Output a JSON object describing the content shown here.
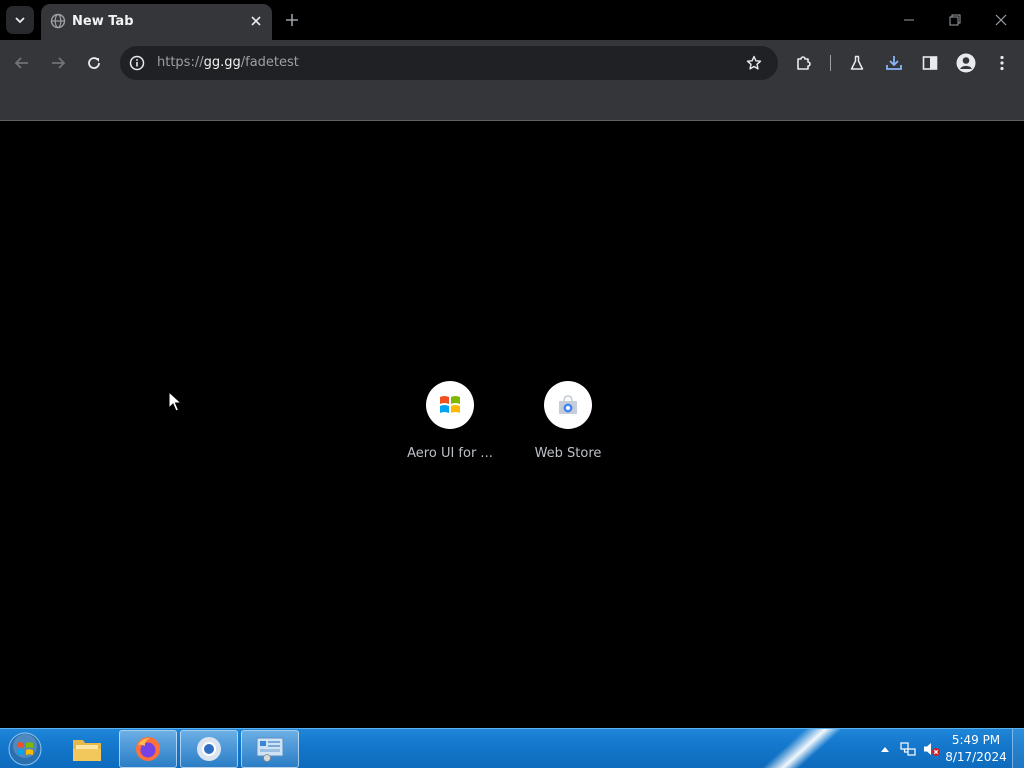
{
  "browser": {
    "tab": {
      "title": "New Tab"
    },
    "address_bar": {
      "scheme": "https://",
      "host": "gg.gg",
      "path": "/fadetest"
    }
  },
  "shortcuts": [
    {
      "label": "Aero UI for ...",
      "icon": "windows-logo-icon"
    },
    {
      "label": "Web Store",
      "icon": "web-store-icon"
    }
  ],
  "taskbar": {
    "apps": [
      {
        "name": "file-explorer",
        "running": false
      },
      {
        "name": "firefox",
        "running": true
      },
      {
        "name": "chrome",
        "running": true
      },
      {
        "name": "control-panel",
        "running": true
      }
    ],
    "clock": {
      "time": "5:49 PM",
      "date": "8/17/2024"
    }
  },
  "colors": {
    "tab_active": "#35363a",
    "toolbar": "#35363a",
    "omnibox": "#202124",
    "page_background": "#000000",
    "taskbar": "#1478cc",
    "download_icon": "#8ab4f8"
  }
}
